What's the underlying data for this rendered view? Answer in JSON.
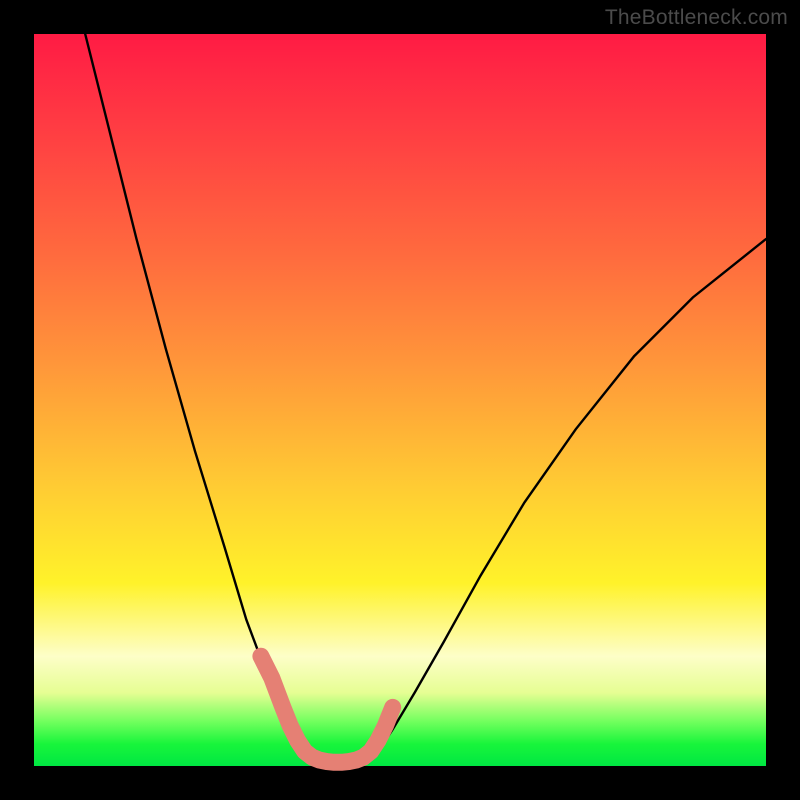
{
  "watermark": "TheBottleneck.com",
  "chart_data": {
    "type": "line",
    "title": "",
    "xlabel": "",
    "ylabel": "",
    "xlim": [
      0,
      100
    ],
    "ylim": [
      0,
      100
    ],
    "series": [
      {
        "name": "black-curve",
        "color": "#000000",
        "x": [
          7,
          10,
          14,
          18,
          22,
          26,
          29,
          32,
          34,
          36,
          37.5,
          39,
          41,
          43,
          45,
          47,
          49,
          52,
          56,
          61,
          67,
          74,
          82,
          90,
          100
        ],
        "y": [
          100,
          88,
          72,
          57,
          43,
          30,
          20,
          12,
          7,
          4,
          2,
          1,
          0.5,
          0.5,
          0.8,
          2,
          5,
          10,
          17,
          26,
          36,
          46,
          56,
          64,
          72
        ]
      },
      {
        "name": "salmon-highlight",
        "color": "#e58074",
        "x": [
          31,
          32.5,
          34,
          35,
          36,
          37,
          38,
          39,
          40,
          41,
          42,
          43,
          44,
          45,
          46,
          47,
          48,
          49
        ],
        "y": [
          15,
          12,
          8,
          5.5,
          3.5,
          2,
          1.2,
          0.8,
          0.6,
          0.5,
          0.5,
          0.6,
          0.8,
          1.2,
          2,
          3.5,
          5.5,
          8
        ]
      }
    ]
  },
  "colors": {
    "background": "#000000",
    "gradient_top": "#ff1b44",
    "gradient_mid": "#fff22a",
    "gradient_bottom": "#00e742",
    "curve": "#000000",
    "highlight": "#e58074",
    "watermark": "#4b4b4b"
  }
}
